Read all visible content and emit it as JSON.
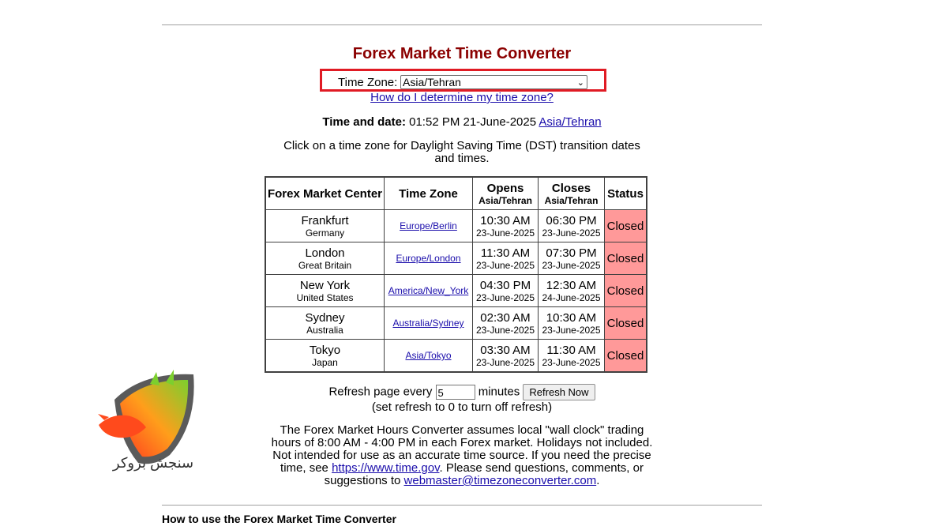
{
  "title": "Forex Market Time Converter",
  "timezone": {
    "label": "Time Zone:",
    "selected": "Asia/Tehran",
    "help_link": "How do I determine my time zone?"
  },
  "time_date": {
    "label": "Time and date:",
    "value": "01:52 PM 21-June-2025",
    "zone_link": "Asia/Tehran"
  },
  "dst_note": "Click on a time zone for Daylight Saving Time (DST) transition dates and times.",
  "table": {
    "headers": {
      "center": "Forex Market Center",
      "zone": "Time Zone",
      "opens": "Opens",
      "opens_sub": "Asia/Tehran",
      "closes": "Closes",
      "closes_sub": "Asia/Tehran",
      "status": "Status"
    },
    "rows": [
      {
        "city": "Frankfurt",
        "country": "Germany",
        "zone": "Europe/Berlin",
        "open_time": "10:30 AM",
        "open_date": "23-June-2025",
        "close_time": "06:30 PM",
        "close_date": "23-June-2025",
        "status": "Closed"
      },
      {
        "city": "London",
        "country": "Great Britain",
        "zone": "Europe/London",
        "open_time": "11:30 AM",
        "open_date": "23-June-2025",
        "close_time": "07:30 PM",
        "close_date": "23-June-2025",
        "status": "Closed"
      },
      {
        "city": "New York",
        "country": "United States",
        "zone": "America/New_York",
        "open_time": "04:30 PM",
        "open_date": "23-June-2025",
        "close_time": "12:30 AM",
        "close_date": "24-June-2025",
        "status": "Closed"
      },
      {
        "city": "Sydney",
        "country": "Australia",
        "zone": "Australia/Sydney",
        "open_time": "02:30 AM",
        "open_date": "23-June-2025",
        "close_time": "10:30 AM",
        "close_date": "23-June-2025",
        "status": "Closed"
      },
      {
        "city": "Tokyo",
        "country": "Japan",
        "zone": "Asia/Tokyo",
        "open_time": "03:30 AM",
        "open_date": "23-June-2025",
        "close_time": "11:30 AM",
        "close_date": "23-June-2025",
        "status": "Closed"
      }
    ]
  },
  "refresh": {
    "label_before": "Refresh page every",
    "value": "5",
    "label_after": "minutes",
    "button": "Refresh Now",
    "note": "(set refresh to 0 to turn off refresh)"
  },
  "disclaimer": {
    "text_1": "The Forex Market Hours Converter assumes local \"wall clock\" trading hours of 8:00 AM - 4:00 PM in each Forex market. Holidays not included. Not intended for use as an accurate time source. If you need the precise time, see ",
    "link_1": "https://www.time.gov",
    "text_2": ". Please send questions, comments, or suggestions to ",
    "link_2": "webmaster@timezoneconverter.com",
    "text_3": "."
  },
  "howto_heading": "How to use the Forex Market Time Converter",
  "watermark": {
    "text": "سنجش بروکر",
    "icon": "bull-logo-icon"
  },
  "colors": {
    "title": "#8b0000",
    "highlight_box": "#e01b24",
    "closed_status": "#ff9999",
    "link": "#1a0dab"
  }
}
